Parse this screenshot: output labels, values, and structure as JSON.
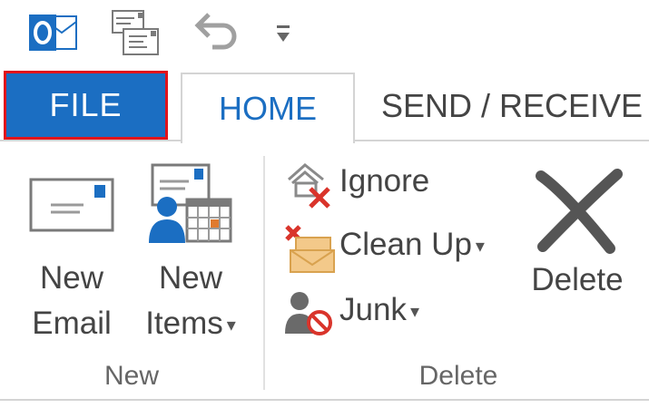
{
  "tabs": {
    "file": "FILE",
    "home": "HOME",
    "send_receive": "SEND / RECEIVE"
  },
  "ribbon": {
    "new_group": {
      "label": "New",
      "new_email": {
        "line1": "New",
        "line2": "Email"
      },
      "new_items": {
        "line1": "New",
        "line2": "Items",
        "caret": "▾"
      }
    },
    "delete_group": {
      "label": "Delete",
      "ignore": "Ignore",
      "clean_up": "Clean Up",
      "clean_up_caret": "▾",
      "junk": "Junk",
      "junk_caret": "▾",
      "delete": "Delete"
    }
  },
  "icons": {
    "app": "outlook-icon",
    "send_all": "send-receive-all-folders-icon",
    "undo": "undo-icon",
    "customize": "customize-quick-access-icon"
  },
  "colors": {
    "accent": "#1b6ec2",
    "highlight_border": "#e1141b"
  }
}
